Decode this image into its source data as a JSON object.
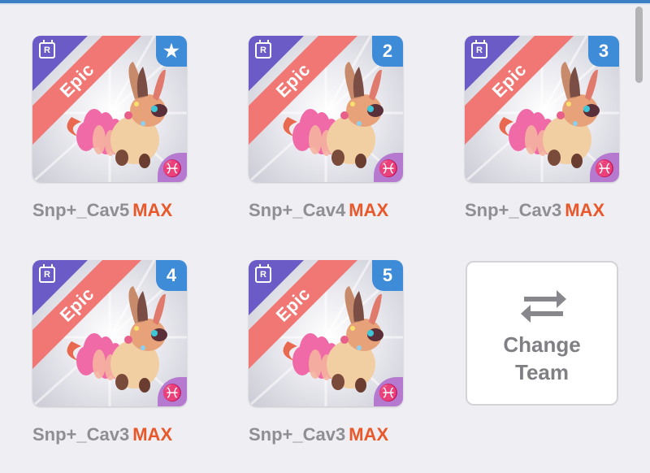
{
  "colors": {
    "rarity_ribbon": "#f17775",
    "rarity_corner": "#6a5bc7",
    "slot_badge": "#3e8bd8",
    "element_badge": "#b57ad0",
    "max_text": "#e8582a",
    "name_text": "#8e8e93"
  },
  "team": [
    {
      "rarity": "Epic",
      "badge": "R",
      "slot": "★",
      "slot_icon": "star-icon",
      "element": "♓",
      "name": "Snp+_Cav5",
      "level": "MAX"
    },
    {
      "rarity": "Epic",
      "badge": "R",
      "slot": "2",
      "element": "♓",
      "name": "Snp+_Cav4",
      "level": "MAX"
    },
    {
      "rarity": "Epic",
      "badge": "R",
      "slot": "3",
      "element": "♓",
      "name": "Snp+_Cav3",
      "level": "MAX"
    },
    {
      "rarity": "Epic",
      "badge": "R",
      "slot": "4",
      "element": "♓",
      "name": "Snp+_Cav3",
      "level": "MAX"
    },
    {
      "rarity": "Epic",
      "badge": "R",
      "slot": "5",
      "element": "♓",
      "name": "Snp+_Cav3",
      "level": "MAX"
    }
  ],
  "change_team": {
    "label": "Change\nTeam",
    "icon": "swap-arrows-icon"
  }
}
